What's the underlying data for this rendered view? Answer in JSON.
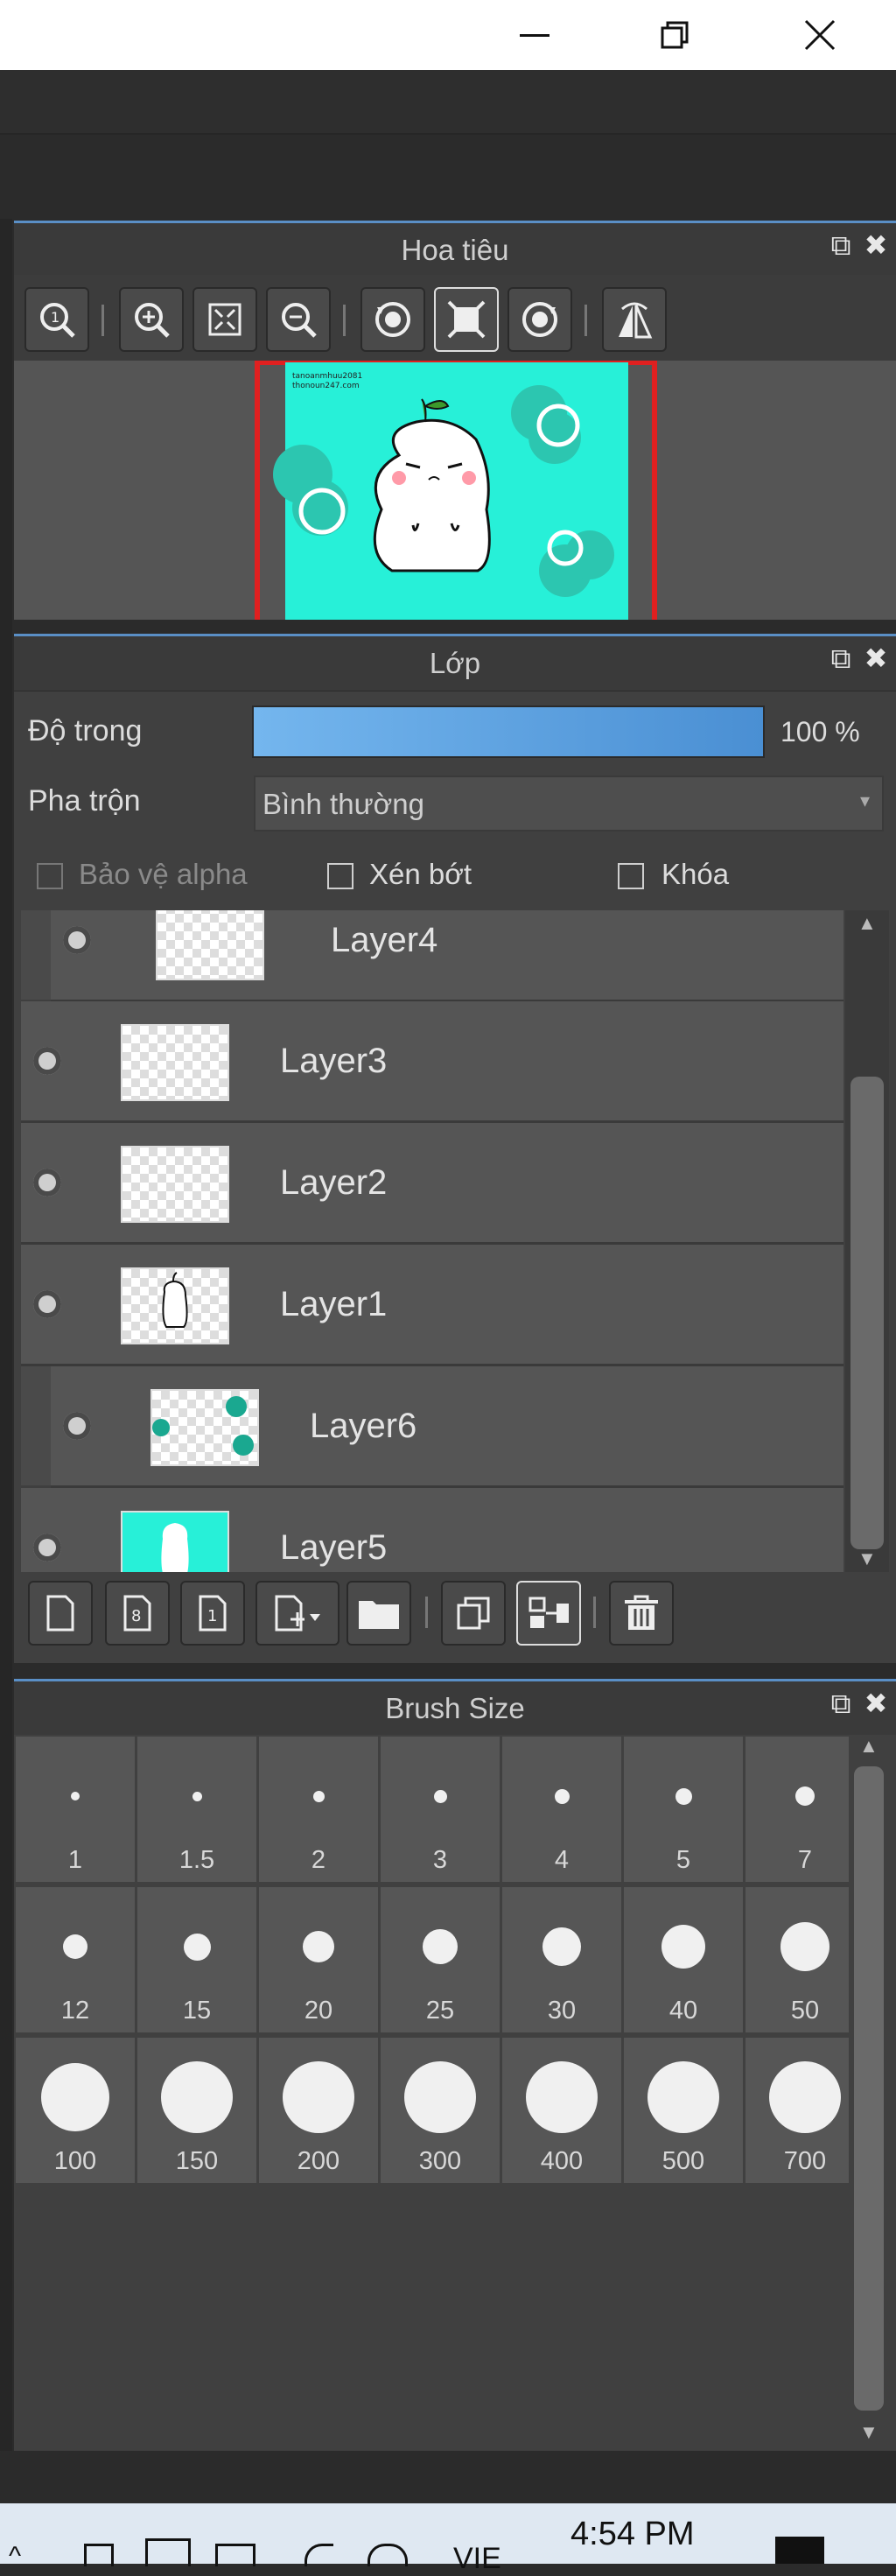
{
  "window": {
    "minimize_icon": "minimize-icon",
    "restore_icon": "restore-icon",
    "close_icon": "close-icon"
  },
  "navigator": {
    "title": "Hoa tiêu",
    "preview_text_line1": "tanoanmhuu2081",
    "preview_text_line2": "thonoun247.com"
  },
  "layers": {
    "title": "Lớp",
    "opacity_label": "Độ trong",
    "opacity_value": "100 %",
    "opacity_fraction": 1.0,
    "blend_label": "Pha trộn",
    "blend_value": "Bình thường",
    "protect_alpha": "Bảo vệ alpha",
    "clipping": "Xén bớt",
    "lock": "Khóa",
    "items": [
      {
        "name": "Layer4"
      },
      {
        "name": "Layer3"
      },
      {
        "name": "Layer2"
      },
      {
        "name": "Layer1"
      },
      {
        "name": "Layer6"
      },
      {
        "name": "Layer5"
      }
    ]
  },
  "brush": {
    "title": "Brush Size",
    "sizes": [
      "1",
      "1.5",
      "2",
      "3",
      "4",
      "5",
      "7",
      "12",
      "15",
      "20",
      "25",
      "30",
      "40",
      "50",
      "100",
      "150",
      "200",
      "300",
      "400",
      "500",
      "700"
    ]
  },
  "taskbar": {
    "time": "4:54 PM",
    "lang": "VIE"
  },
  "colors": {
    "accent": "#5a8fc6",
    "canvas": "#27f0d8",
    "selection": "#e02020"
  }
}
